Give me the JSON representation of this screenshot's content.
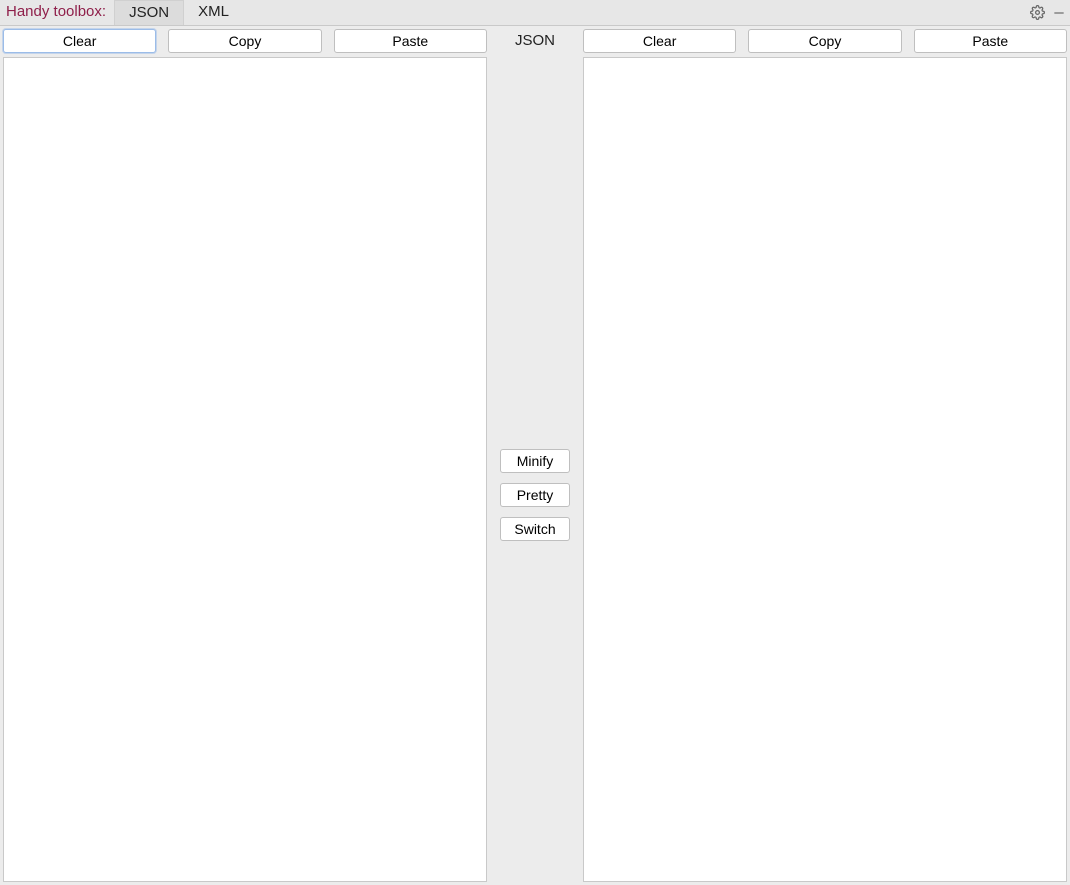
{
  "header": {
    "brand": "Handy toolbox:",
    "tabs": [
      {
        "label": "JSON",
        "active": true
      },
      {
        "label": "XML",
        "active": false
      }
    ]
  },
  "left": {
    "clear": "Clear",
    "copy": "Copy",
    "paste": "Paste",
    "value": ""
  },
  "right": {
    "clear": "Clear",
    "copy": "Copy",
    "paste": "Paste",
    "value": ""
  },
  "center": {
    "mode": "JSON",
    "minify": "Minify",
    "pretty": "Pretty",
    "switch": "Switch"
  }
}
